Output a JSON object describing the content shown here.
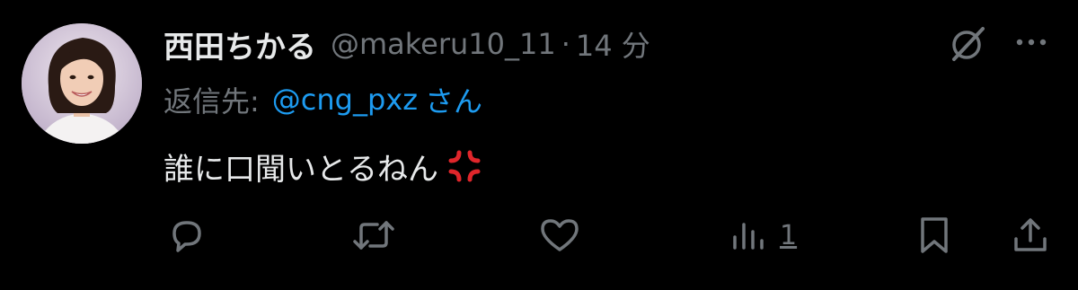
{
  "tweet": {
    "author_name": "西田ちかる",
    "author_handle": "@makeru10_11",
    "separator": "·",
    "timestamp": "14 分",
    "reply_prefix": "返信先:",
    "reply_handle": "@cng_pxz",
    "reply_suffix": "さん",
    "text": "誰に口聞いとるねん",
    "emoji": "anger-symbol-icon"
  },
  "actions": {
    "reply": {
      "icon": "reply-icon"
    },
    "repost": {
      "icon": "repost-icon"
    },
    "like": {
      "icon": "heart-icon"
    },
    "views": {
      "icon": "views-bar-chart-icon",
      "count": "1"
    },
    "bookmark": {
      "icon": "bookmark-icon"
    },
    "share": {
      "icon": "share-icon"
    }
  },
  "colors": {
    "background": "#000000",
    "primary_text": "#e7e9ea",
    "secondary_text": "#71767b",
    "link": "#1d9bf0",
    "anger_red": "#e0262b"
  }
}
